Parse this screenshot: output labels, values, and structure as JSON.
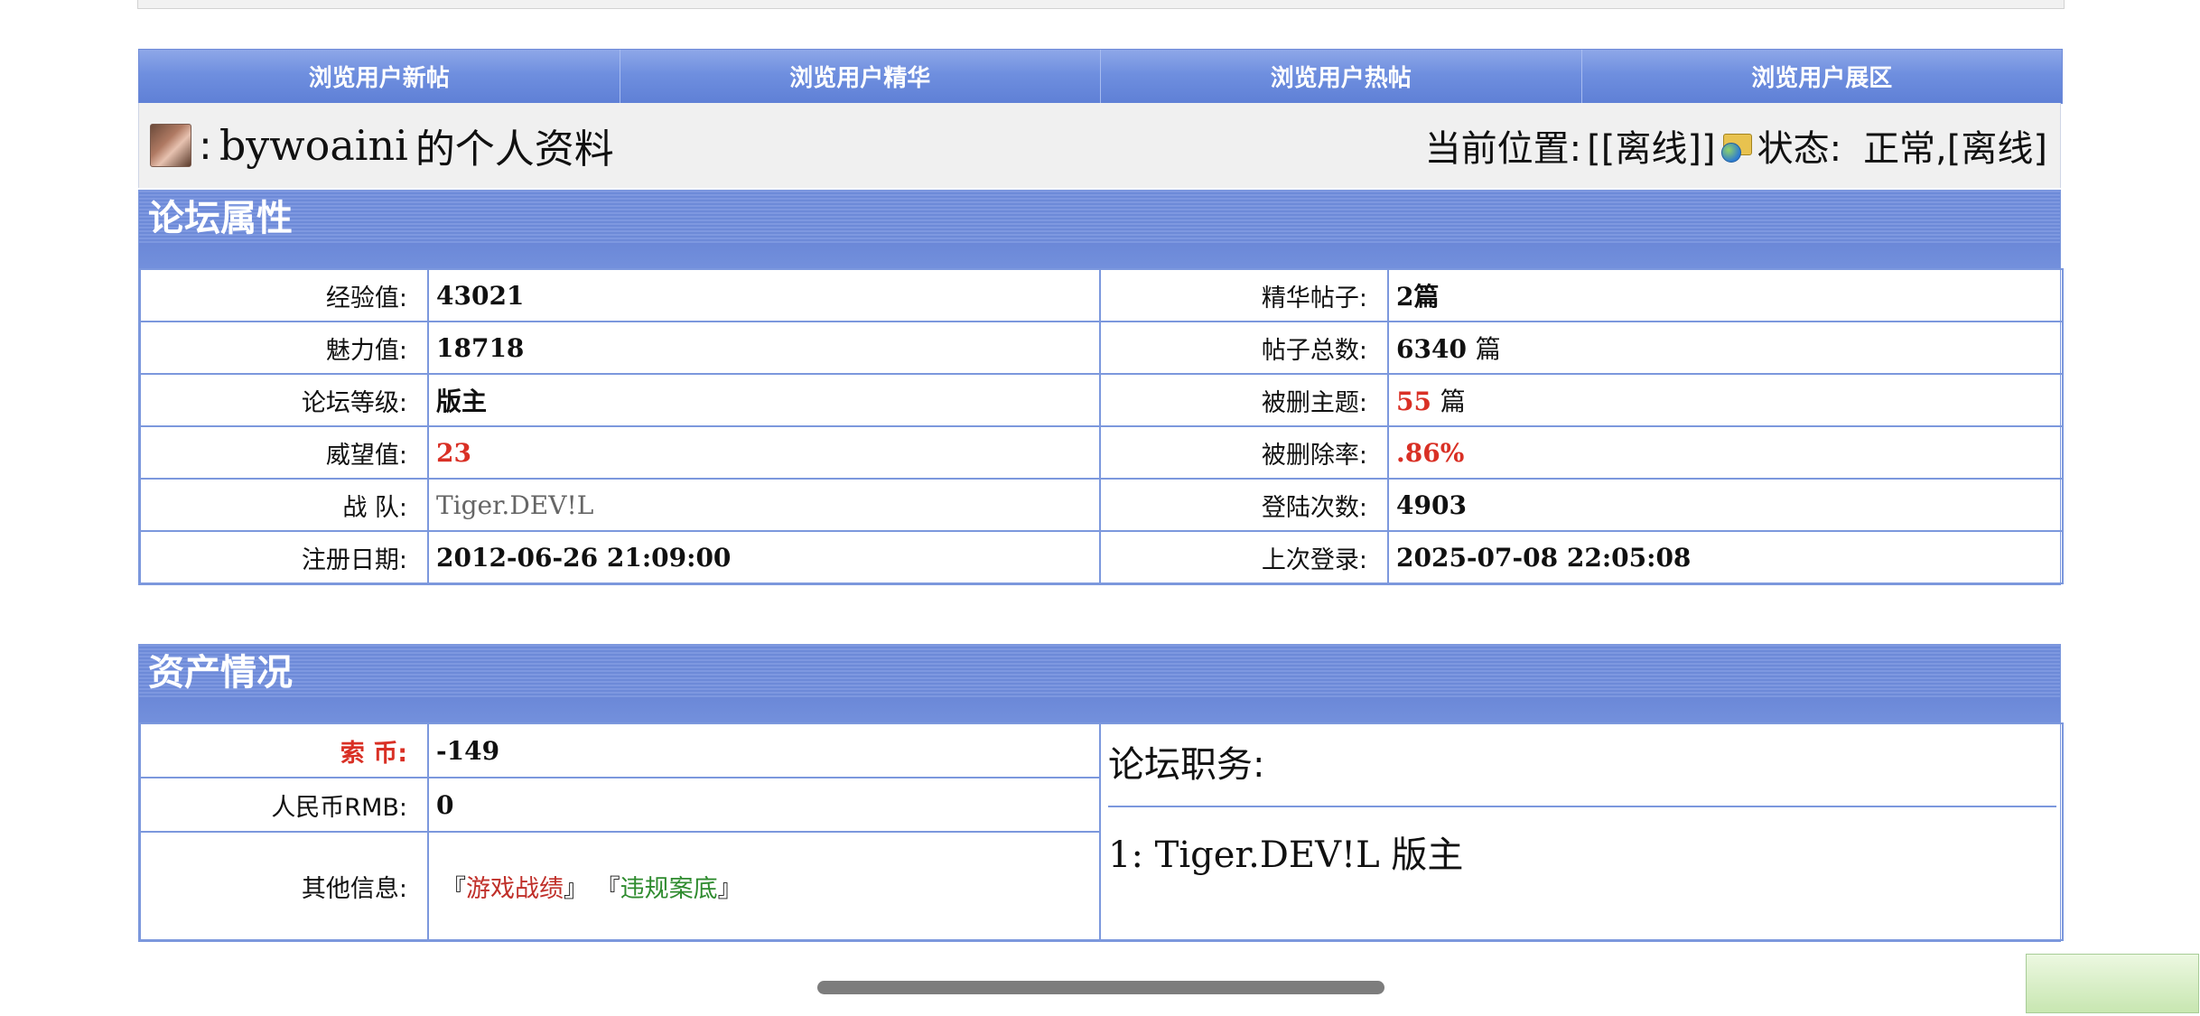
{
  "nav": {
    "items": [
      "浏览用户新帖",
      "浏览用户精华",
      "浏览用户热帖",
      "浏览用户展区"
    ]
  },
  "profile": {
    "colon": ":",
    "username": "bywoaini",
    "title_suffix": "的个人资料",
    "location_label": "当前位置:",
    "location_value": "[[离线]]",
    "status_label": "状态:",
    "status_value": "正常,[离线]"
  },
  "forum_attr": {
    "title": "论坛属性",
    "rows": [
      {
        "l_label": "经验值:",
        "l_value": "43021",
        "r_label": "精华帖子:",
        "r_value": "2篇"
      },
      {
        "l_label": "魅力值:",
        "l_value": "18718",
        "r_label": "帖子总数:",
        "r_value": "6340",
        "r_unit": "篇"
      },
      {
        "l_label": "论坛等级:",
        "l_value": "版主",
        "r_label": "被删主题:",
        "r_value": "55",
        "r_unit": "篇"
      },
      {
        "l_label": "威望值:",
        "l_value": "23",
        "r_label": "被删除率:",
        "r_value": ".86%"
      },
      {
        "l_label": "战 队:",
        "l_value": "Tiger.DEV!L",
        "r_label": "登陆次数:",
        "r_value": "4903"
      },
      {
        "l_label": "注册日期:",
        "l_value": "2012-06-26 21:09:00",
        "r_label": "上次登录:",
        "r_value": "2025-07-08 22:05:08"
      }
    ]
  },
  "assets": {
    "title": "资产情况",
    "coin_label": "索 币:",
    "coin_value": "-149",
    "rmb_label": "人民币RMB:",
    "rmb_value": "0",
    "other_label": "其他信息:",
    "link1_open": "『",
    "link1": "游戏战绩",
    "link1_close": "』",
    "link2_open": "『",
    "link2": "违规案底",
    "link2_close": "』",
    "duty_title": "论坛职务:",
    "duty_line": "1: Tiger.DEV!L 版主"
  },
  "colors": {
    "nav_bg": "#6f8fdf",
    "border": "#7c98dd",
    "highlight_red": "#d93025"
  }
}
